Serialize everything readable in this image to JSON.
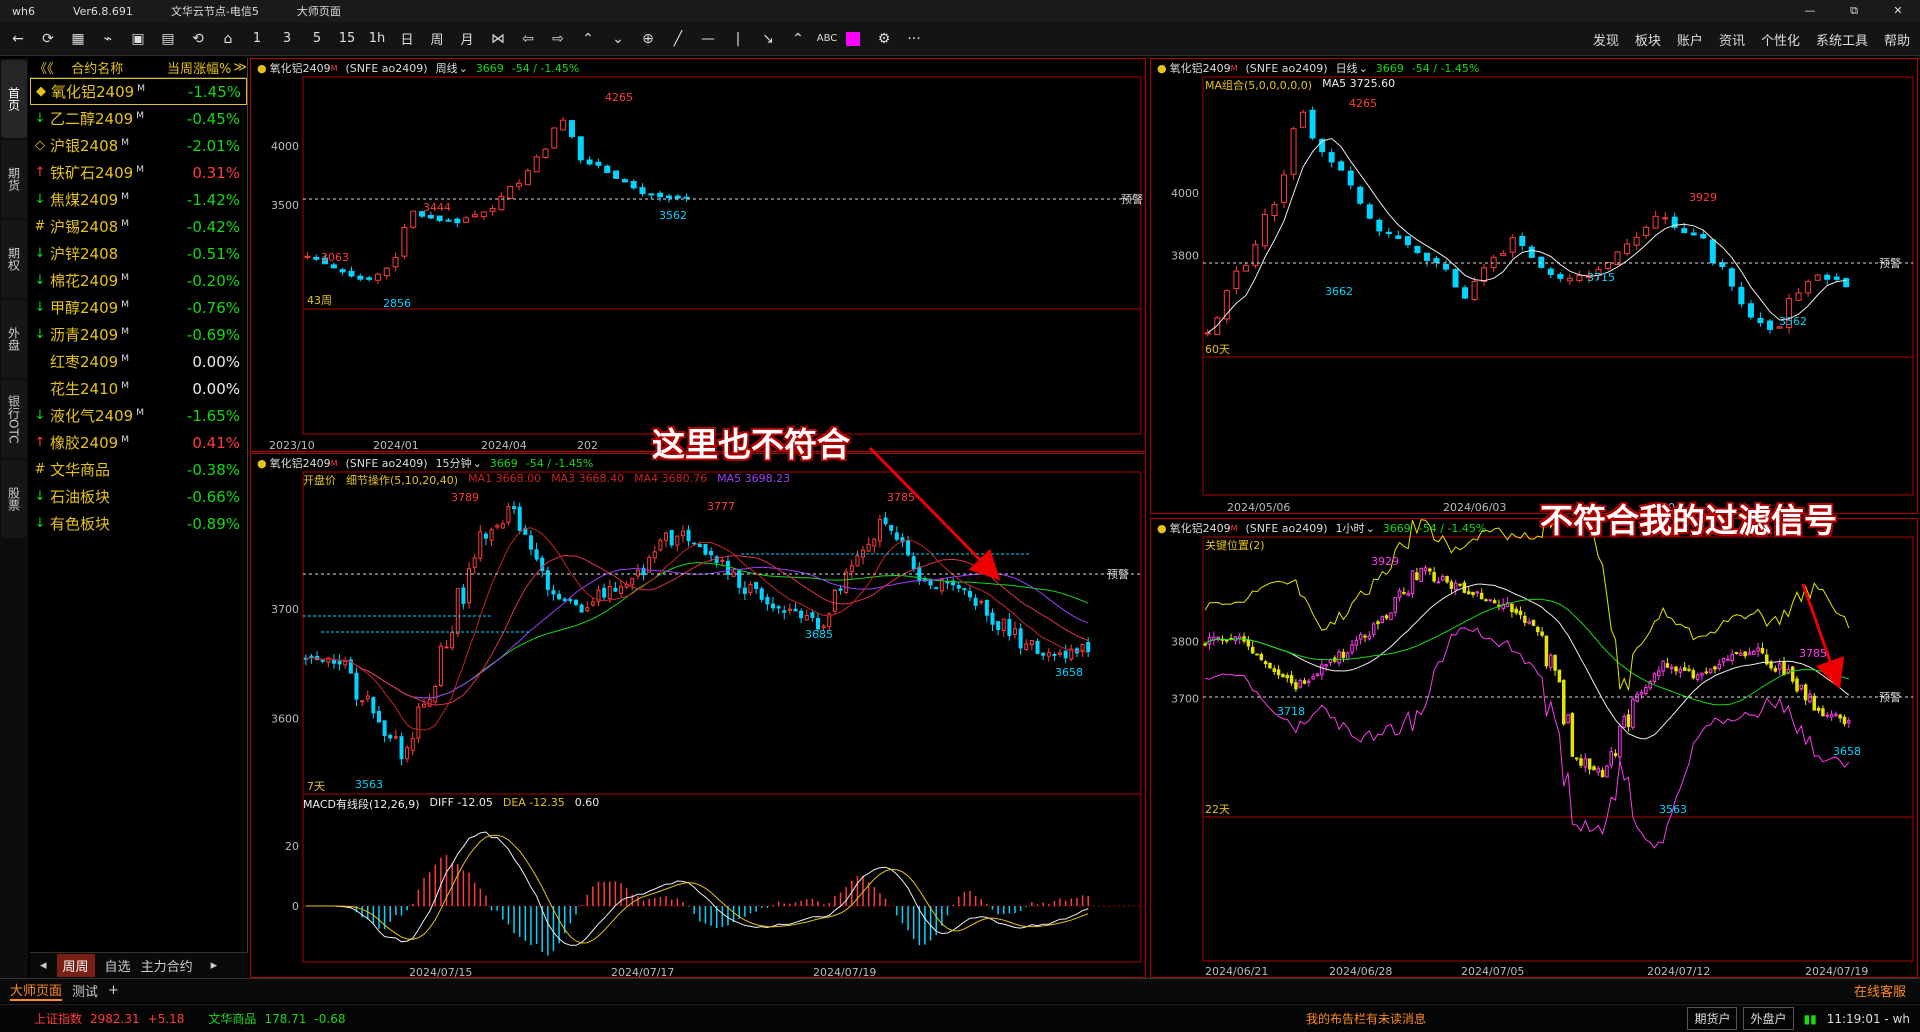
{
  "titlebar": {
    "app": "wh6",
    "version": "Ver6.8.691",
    "server": "文华云节点-电信5",
    "page": "大师页面",
    "controls": [
      "—",
      "⧉",
      "✕"
    ]
  },
  "toolbar": {
    "tools": [
      "←",
      "⟳",
      "▦",
      "⌁",
      "▣",
      "▤",
      "⟲",
      "⌂"
    ],
    "periods": [
      "1",
      "3",
      "5",
      "15",
      "1h",
      "日",
      "周",
      "月"
    ],
    "draw": [
      "⋈",
      "⇦",
      "⇨",
      "⌃",
      "⌄",
      "⊕",
      "╱",
      "—",
      "|",
      "↘",
      "⌃"
    ],
    "abc": "ABC",
    "gear": "⚙",
    "more": "···",
    "menu": [
      "发现",
      "板块",
      "账户",
      "资讯",
      "个性化",
      "系统工具",
      "帮助"
    ]
  },
  "left_tabs": [
    "首页",
    "期货",
    "期权",
    "外盘",
    "银行OTC",
    "股票"
  ],
  "watchlist": {
    "back": "《《",
    "col_name": "合约名称",
    "col_change": "当周涨幅%",
    "arrow": "≫",
    "rows": [
      {
        "icon": "◆",
        "name": "氧化铝2409",
        "sup": "M",
        "change": "-1.45%",
        "dir": "down",
        "icon_color": "#e4c21b",
        "selected": true
      },
      {
        "icon": "↓",
        "name": "乙二醇2409",
        "sup": "M",
        "change": "-0.45%",
        "dir": "down",
        "icon_color": "#16d816"
      },
      {
        "icon": "◇",
        "name": "沪银2408",
        "sup": "M",
        "change": "-2.01%",
        "dir": "down",
        "icon_color": "#e4c21b"
      },
      {
        "icon": "↑",
        "name": "铁矿石2409",
        "sup": "M",
        "change": "0.31%",
        "dir": "up",
        "icon_color": "#ff3b3b"
      },
      {
        "icon": "↓",
        "name": "焦煤2409",
        "sup": "M",
        "change": "-1.42%",
        "dir": "down",
        "icon_color": "#16d816"
      },
      {
        "icon": "#",
        "name": "沪锡2408",
        "sup": "M",
        "change": "-0.42%",
        "dir": "down",
        "icon_color": "#e4c21b"
      },
      {
        "icon": "↓",
        "name": "沪锌2408",
        "sup": "",
        "change": "-0.51%",
        "dir": "down",
        "icon_color": "#16d816"
      },
      {
        "icon": "↓",
        "name": "棉花2409",
        "sup": "M",
        "change": "-0.20%",
        "dir": "down",
        "icon_color": "#16d816"
      },
      {
        "icon": "↓",
        "name": "甲醇2409",
        "sup": "M",
        "change": "-0.76%",
        "dir": "down",
        "icon_color": "#16d816"
      },
      {
        "icon": "↓",
        "name": "沥青2409",
        "sup": "M",
        "change": "-0.69%",
        "dir": "down",
        "icon_color": "#16d816"
      },
      {
        "icon": "",
        "name": "红枣2409",
        "sup": "M",
        "change": "0.00%",
        "dir": "flat",
        "icon_color": "#ccc"
      },
      {
        "icon": "",
        "name": "花生2410",
        "sup": "M",
        "change": "0.00%",
        "dir": "flat",
        "icon_color": "#ccc"
      },
      {
        "icon": "↓",
        "name": "液化气2409",
        "sup": "M",
        "change": "-1.65%",
        "dir": "down",
        "icon_color": "#16d816"
      },
      {
        "icon": "↑",
        "name": "橡胶2409",
        "sup": "M",
        "change": "0.41%",
        "dir": "up",
        "icon_color": "#ff3b3b"
      },
      {
        "icon": "#",
        "name": "文华商品",
        "sup": "",
        "change": "-0.38%",
        "dir": "down",
        "icon_color": "#e4c21b"
      },
      {
        "icon": "↓",
        "name": "石油板块",
        "sup": "",
        "change": "-0.66%",
        "dir": "down",
        "icon_color": "#16d816"
      },
      {
        "icon": "↓",
        "name": "有色板块",
        "sup": "",
        "change": "-0.89%",
        "dir": "down",
        "icon_color": "#16d816"
      }
    ],
    "bottom_tabs": [
      "周周",
      "自选",
      "主力合约"
    ],
    "bottom_nav": [
      "◂",
      "▸"
    ]
  },
  "common": {
    "symbol": "氧化铝2409",
    "sup": "M",
    "exch": "(SNFE ao2409)",
    "price": "3669",
    "chg": "-54 / -1.45%",
    "warn": "预警"
  },
  "panels": {
    "weekly": {
      "period": "周线",
      "xticks": [
        "2023/10",
        "2024/01",
        "2024/04",
        "202"
      ],
      "yticks": [
        "4000",
        "3500"
      ],
      "labels": [
        "4265",
        "3444",
        "3063",
        "2856",
        "3562"
      ],
      "count": "43周"
    },
    "min15": {
      "period": "15分钟",
      "row2": [
        "开盘价",
        "细节操作(5,10,20,40)",
        "MA1 3668.00",
        "MA3 3668.40",
        "MA4 3680.76",
        "MA5 3698.23"
      ],
      "yticks": [
        "3700",
        "3600"
      ],
      "labels": [
        "3789",
        "3777",
        "3785",
        "3685",
        "3658",
        "3563"
      ],
      "count": "7天",
      "macd": [
        "MACD有线段(12,26,9)",
        "DIFF -12.05",
        "DEA -12.35",
        "0.60"
      ],
      "macd_y": [
        "20",
        "0"
      ],
      "xticks": [
        "2024/07/15",
        "2024/07/17",
        "2024/07/19"
      ]
    },
    "daily": {
      "period": "日线",
      "row2": [
        "MA组合(5,0,0,0,0,0)",
        "MA5 3725.60"
      ],
      "yticks": [
        "4000",
        "3800"
      ],
      "labels": [
        "4265",
        "3929",
        "3662",
        "3715",
        "3562"
      ],
      "count": "60天",
      "xticks": [
        "2024/05/06",
        "2024/06/03",
        "20"
      ]
    },
    "hour": {
      "period": "1小时",
      "row2": [
        "关键位置(2)"
      ],
      "yticks": [
        "3800",
        "3700"
      ],
      "labels": [
        "3929",
        "3718",
        "3785",
        "3658",
        "3563"
      ],
      "count": "22天",
      "xticks": [
        "2024/06/21",
        "2024/06/28",
        "2024/07/05",
        "2024/07/12",
        "2024/07/19"
      ]
    }
  },
  "annotations": {
    "a1": "这里也不符合",
    "a2": "不符合我的过滤信号"
  },
  "bottom": {
    "tabs": [
      "大师页面",
      "测试"
    ],
    "add": "+",
    "service": "在线客服"
  },
  "status": {
    "idx1_name": "上证指数",
    "idx1_val": "2982.31",
    "idx1_chg": "+5.18",
    "idx2_name": "文华商品",
    "idx2_val": "178.71",
    "idx2_chg": "-0.68",
    "msg": "我的布告栏有未读消息",
    "btn1": "期货户",
    "btn2": "外盘户",
    "time": "11:19:01 - wh"
  }
}
